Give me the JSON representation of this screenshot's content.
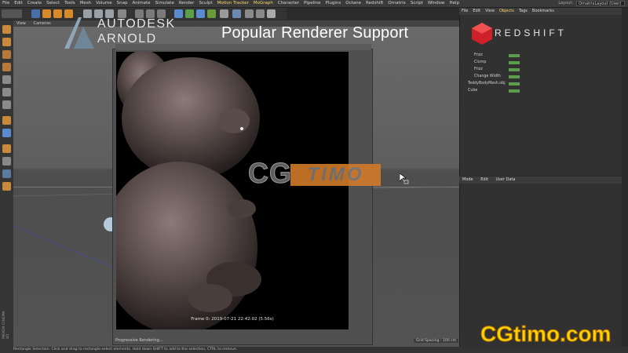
{
  "menu": [
    "File",
    "Edit",
    "Create",
    "Select",
    "Tools",
    "Mesh",
    "Volume",
    "Snap",
    "Animate",
    "Simulate",
    "Render",
    "Sculpt",
    "Motion Tracker",
    "MoGraph",
    "Character",
    "Pipeline",
    "Plugins",
    "Octane",
    "Redshift",
    "Ornatrix",
    "Script",
    "Window",
    "Help"
  ],
  "layout": {
    "label": "Layout:",
    "value": "OrnatrixLayout (User)"
  },
  "viewport_menu": [
    "View",
    "Cameras"
  ],
  "overlay_title": "Popular Renderer Support",
  "arnold": {
    "line1": "AUTODESK",
    "line2": "ARNOLD"
  },
  "redshift": {
    "text": "REDSHIFT"
  },
  "object_manager": {
    "menu": [
      "File",
      "Edit",
      "View",
      "Objects",
      "Tags",
      "Bookmarks"
    ],
    "active_menu": "Objects",
    "rows": [
      {
        "name": "Frizz",
        "indent": 12,
        "tag": true
      },
      {
        "name": "Clump",
        "indent": 12,
        "tag": true
      },
      {
        "name": "Frizz",
        "indent": 12,
        "tag": true
      },
      {
        "name": "Change Width",
        "indent": 12,
        "tag": true
      },
      {
        "name": "TeddyBodyMesh.obj",
        "indent": 4,
        "tag": true
      },
      {
        "name": "Cube",
        "indent": 4,
        "tag": true
      }
    ]
  },
  "attribute_manager": {
    "menu": [
      "Mode",
      "Edit",
      "User Data"
    ]
  },
  "render": {
    "caption": "Frame 0:  2019-07-21  22:42:02  (5.56s)",
    "progress": "Progressive Rendering..."
  },
  "grid_spacing": "Grid Spacing : 100 cm",
  "status": "Rectangle Selection: Click and drag to rectangle-select elements. Hold down SHIFT to add to the selection, CTRL to remove.",
  "watermark": {
    "cg": "CG",
    "timo": "TIMO",
    "site": "CGtimo.com"
  },
  "maxon": "MAXON CINEMA 4D",
  "colors": {
    "accent": "#ffd866",
    "redshift": "#d0202a",
    "watermark_orange": "#d27a2a",
    "site_yellow": "#ffd400"
  }
}
